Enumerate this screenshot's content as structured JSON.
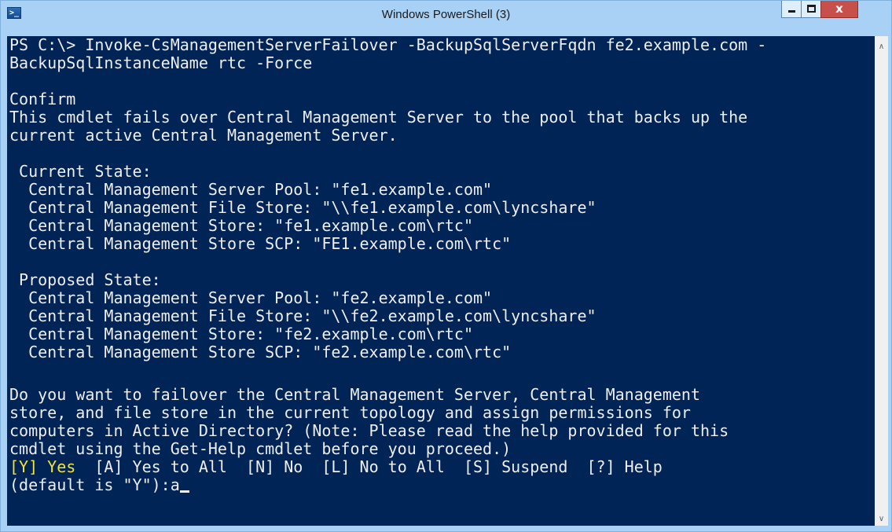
{
  "window": {
    "title": "Windows PowerShell (3)",
    "close_glyph": "x"
  },
  "app_icon": {
    "glyph": ">_",
    "icon": "powershell-icon"
  },
  "console": {
    "background": "#012456",
    "foreground": "#eeedf0",
    "highlight": "#f0e33a",
    "lines": [
      "PS C:\\> Invoke-CsManagementServerFailover -BackupSqlServerFqdn fe2.example.com -",
      "BackupSqlInstanceName rtc -Force",
      "",
      "Confirm",
      "This cmdlet fails over Central Management Server to the pool that backs up the",
      "current active Central Management Server.",
      "",
      " Current State:",
      "  Central Management Server Pool: \"fe1.example.com\"",
      "  Central Management File Store: \"\\\\fe1.example.com\\lyncshare\"",
      "  Central Management Store: \"fe1.example.com\\rtc\"",
      "  Central Management Store SCP: \"FE1.example.com\\rtc\"",
      "",
      " Proposed State:",
      "  Central Management Server Pool: \"fe2.example.com\"",
      "  Central Management File Store: \"\\\\fe2.example.com\\lyncshare\"",
      "  Central Management Store: \"fe2.example.com\\rtc\"",
      "  Central Management Store SCP: \"fe2.example.com\\rtc\"",
      "",
      "",
      "Do you want to failover the Central Management Server, Central Management",
      "store, and file store in the current topology and assign permissions for",
      "computers in Active Directory? (Note: Please read the help provided for this",
      "cmdlet using the Get-Help cmdlet before you proceed.)"
    ],
    "choice_default": "[Y] Yes",
    "choice_rest": "  [A] Yes to All  [N] No  [L] No to All  [S] Suspend  [?] Help",
    "prompt": "(default is \"Y\"):",
    "input_value": "a"
  },
  "scrollbar": {
    "up_arrow": "∧",
    "down_arrow": "∨"
  }
}
